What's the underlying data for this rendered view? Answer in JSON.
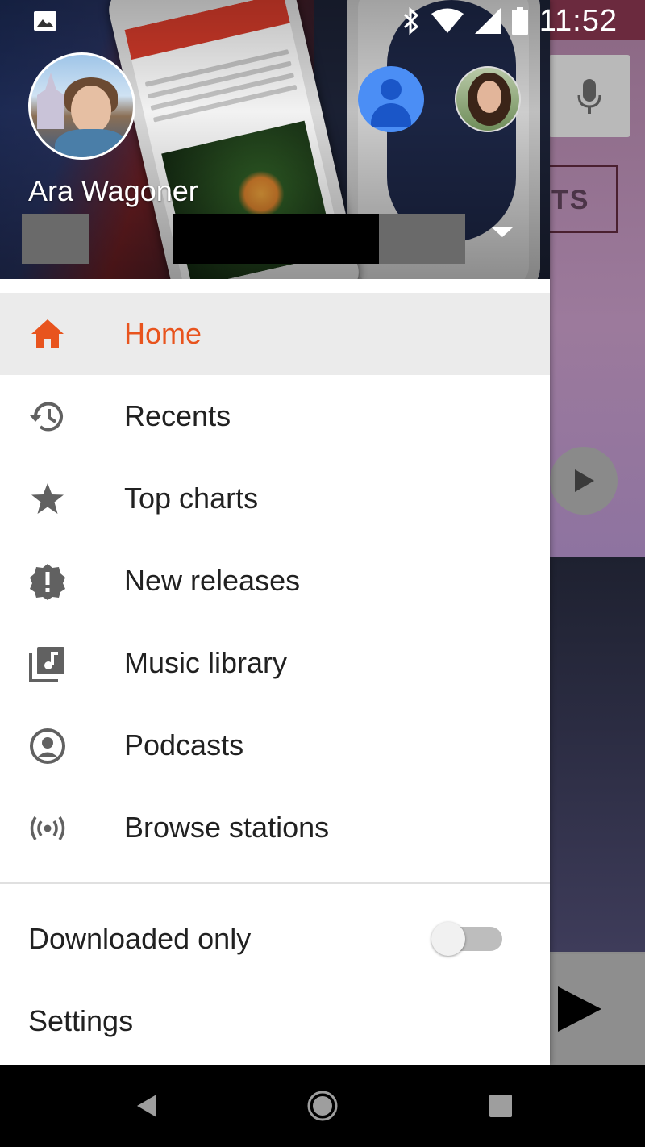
{
  "status_bar": {
    "time": "11:52",
    "icons": [
      "gallery-icon",
      "bluetooth-icon",
      "wifi-icon",
      "cell-signal-icon",
      "battery-icon"
    ]
  },
  "drawer": {
    "account_name": "Ara Wagoner",
    "nav_items": [
      {
        "label": "Home",
        "icon": "home-icon",
        "active": true
      },
      {
        "label": "Recents",
        "icon": "history-icon",
        "active": false
      },
      {
        "label": "Top charts",
        "icon": "star-icon",
        "active": false
      },
      {
        "label": "New releases",
        "icon": "new-releases-icon",
        "active": false
      },
      {
        "label": "Music library",
        "icon": "music-library-icon",
        "active": false
      },
      {
        "label": "Podcasts",
        "icon": "podcast-icon",
        "active": false
      },
      {
        "label": "Browse stations",
        "icon": "radio-icon",
        "active": false
      }
    ],
    "downloaded_only": {
      "label": "Downloaded only",
      "enabled": false
    },
    "settings_label": "Settings"
  },
  "background_app": {
    "button_text": "TS"
  },
  "colors": {
    "accent": "#e8541e",
    "icon_grey": "#616161",
    "text": "#212121"
  }
}
